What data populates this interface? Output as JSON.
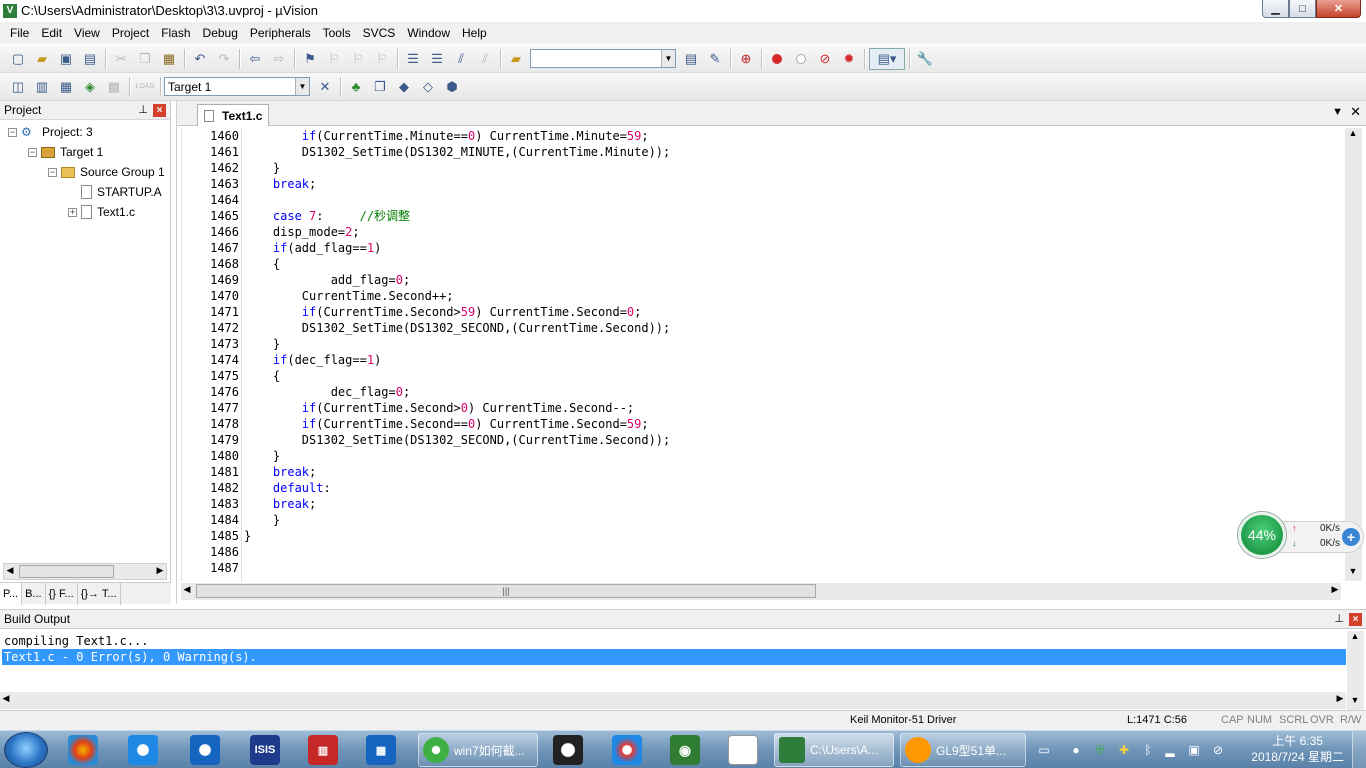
{
  "window": {
    "title": "C:\\Users\\Administrator\\Desktop\\3\\3.uvproj - µVision",
    "app_icon": "V",
    "controls": [
      "minimize-icon",
      "maximize-icon",
      "close-icon"
    ],
    "min_glyph": "▁",
    "max_glyph": "□",
    "close_glyph": "✕"
  },
  "menu": [
    "File",
    "Edit",
    "View",
    "Project",
    "Flash",
    "Debug",
    "Peripherals",
    "Tools",
    "SVCS",
    "Window",
    "Help"
  ],
  "toolbar2": {
    "target_select": "Target 1",
    "load_label": "LOAD"
  },
  "project_panel": {
    "title": "Project",
    "tree": [
      {
        "label": "Project: 3"
      },
      {
        "label": "Target 1"
      },
      {
        "label": "Source Group 1"
      },
      {
        "label": "STARTUP.A"
      },
      {
        "label": "Text1.c"
      }
    ],
    "tabs": [
      "P...",
      "B...",
      "{} F...",
      "{}→ T..."
    ]
  },
  "editor": {
    "tab": "Text1.c",
    "lines": [
      {
        "n": "1460",
        "indent": "        ",
        "html": "<span class=\"kw\">if</span>(CurrentTime.Minute==<span class=\"num\">0</span>) CurrentTime.Minute=<span class=\"num\">59</span>;"
      },
      {
        "n": "1461",
        "indent": "        ",
        "html": "DS1302_SetTime(DS1302_MINUTE,(CurrentTime.Minute));"
      },
      {
        "n": "1462",
        "indent": "    ",
        "html": "}"
      },
      {
        "n": "1463",
        "indent": "    ",
        "html": "<span class=\"kw\">break</span>;"
      },
      {
        "n": "1464",
        "indent": "",
        "html": ""
      },
      {
        "n": "1465",
        "indent": "    ",
        "html": "<span class=\"kw\">case</span> <span class=\"num\">7</span>:     <span class=\"cm\">//秒调整</span>"
      },
      {
        "n": "1466",
        "indent": "    ",
        "html": "disp_mode=<span class=\"num\">2</span>;"
      },
      {
        "n": "1467",
        "indent": "    ",
        "html": "<span class=\"kw\">if</span>(add_flag==<span class=\"num\">1</span>)"
      },
      {
        "n": "1468",
        "indent": "    ",
        "html": "{"
      },
      {
        "n": "1469",
        "indent": "            ",
        "html": "add_flag=<span class=\"num\">0</span>;"
      },
      {
        "n": "1470",
        "indent": "        ",
        "html": "CurrentTime.Second++;"
      },
      {
        "n": "1471",
        "indent": "        ",
        "html": "<span class=\"kw\">if</span>(CurrentTime.Second&gt;<span class=\"num\">59</span>) CurrentTime.Second=<span class=\"num\">0</span>;"
      },
      {
        "n": "1472",
        "indent": "        ",
        "html": "DS1302_SetTime(DS1302_SECOND,(CurrentTime.Second));"
      },
      {
        "n": "1473",
        "indent": "    ",
        "html": "}"
      },
      {
        "n": "1474",
        "indent": "    ",
        "html": "<span class=\"kw\">if</span>(dec_flag==<span class=\"num\">1</span>)"
      },
      {
        "n": "1475",
        "indent": "    ",
        "html": "{"
      },
      {
        "n": "1476",
        "indent": "            ",
        "html": "dec_flag=<span class=\"num\">0</span>;"
      },
      {
        "n": "1477",
        "indent": "        ",
        "html": "<span class=\"kw\">if</span>(CurrentTime.Second&gt;<span class=\"num\">0</span>) CurrentTime.Second--;"
      },
      {
        "n": "1478",
        "indent": "        ",
        "html": "<span class=\"kw\">if</span>(CurrentTime.Second==<span class=\"num\">0</span>) CurrentTime.Second=<span class=\"num\">59</span>;"
      },
      {
        "n": "1479",
        "indent": "        ",
        "html": "DS1302_SetTime(DS1302_SECOND,(CurrentTime.Second));"
      },
      {
        "n": "1480",
        "indent": "    ",
        "html": "}"
      },
      {
        "n": "1481",
        "indent": "    ",
        "html": "<span class=\"kw\">break</span>;"
      },
      {
        "n": "1482",
        "indent": "    ",
        "html": "<span class=\"kw\">default</span>:"
      },
      {
        "n": "1483",
        "indent": "    ",
        "html": "<span class=\"kw\">break</span>;"
      },
      {
        "n": "1484",
        "indent": "    ",
        "html": "}"
      },
      {
        "n": "1485",
        "indent": "",
        "html": "}"
      },
      {
        "n": "1486",
        "indent": "",
        "html": ""
      },
      {
        "n": "1487",
        "indent": "",
        "html": ""
      }
    ]
  },
  "build_output": {
    "title": "Build Output",
    "lines": [
      {
        "text": "compiling Text1.c...",
        "selected": false
      },
      {
        "text": "Text1.c - 0 Error(s), 0 Warning(s).",
        "selected": true
      }
    ]
  },
  "statusbar": {
    "driver": "Keil Monitor-51 Driver",
    "position": "L:1471 C:56",
    "indicators": [
      "CAP",
      "NUM",
      "SCRL",
      "OVR",
      "R/W"
    ]
  },
  "net_widget": {
    "percent": "44%",
    "up_rate": "0K/s",
    "down_rate": "0K/s"
  },
  "taskbar": {
    "buttons": [
      {
        "label": "win7如何截..."
      },
      {
        "label": "C:\\Users\\A..."
      },
      {
        "label": "GL9型51单..."
      }
    ],
    "clock_time": "上午 6:35",
    "clock_date": "2018/7/24 星期二"
  },
  "colors": {
    "keyword": "#0000ff",
    "number": "#e0006a",
    "comment": "#008000",
    "selection": "#3399ff"
  }
}
